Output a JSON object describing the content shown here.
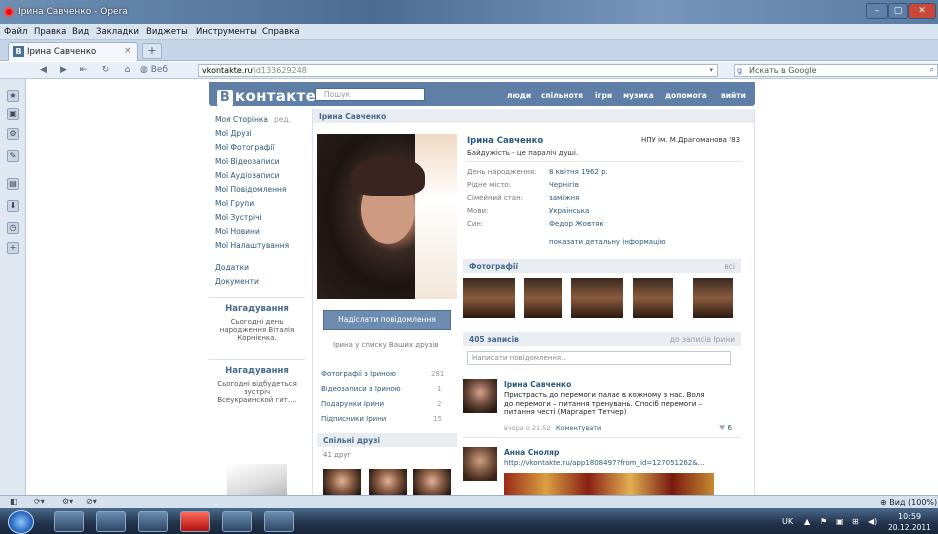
{
  "window": {
    "title": "Ірина Савченко - Opera",
    "min": "–",
    "max": "▢",
    "close": "✕"
  },
  "menu": [
    "Файл",
    "Правка",
    "Вид",
    "Закладки",
    "Виджеты",
    "Инструменты",
    "Справка"
  ],
  "tab": {
    "label": "Ірина Савченко",
    "close": "×",
    "new": "+"
  },
  "address": {
    "host": "vkontakte.ru",
    "path": "/id133629248",
    "web_label": "Веб"
  },
  "search": {
    "placeholder": "Искать в Google"
  },
  "vk": {
    "logo_b": "В",
    "logo": "контакте",
    "search_placeholder": "Пошук",
    "nav": [
      "люди",
      "спільнотя",
      "ігри",
      "музика",
      "допомога",
      "вийти"
    ],
    "left_menu": [
      "Моя Сторінка",
      "Мої Друзі",
      "Мої Фотографії",
      "Мої Відеозаписи",
      "Мої Аудіозаписи",
      "Мої Повідомлення",
      "Мої Групи",
      "Мої Зустрічі",
      "Мої Новини",
      "Мої Налаштування"
    ],
    "edit": "ред.",
    "extra_menu": [
      "Додатки",
      "Документи"
    ],
    "reminders": [
      {
        "title": "Нагадування",
        "text": "Сьогодні день народження Віталія Корнієнка."
      },
      {
        "title": "Нагадування",
        "text": "Сьогодні відбудеться зустріч Всеукраинской гит...."
      }
    ],
    "header": "Ірина Савченко",
    "profile": {
      "name": "Ірина Савченко",
      "school": "НПУ ім. М.Драгоманова '83",
      "status": "Байдужість - це параліч душі.",
      "fields": [
        {
          "label": "День народження:",
          "value": "8 квітня 1962 р."
        },
        {
          "label": "Рідне місто:",
          "value": "Чернігів"
        },
        {
          "label": "Сімейний стан:",
          "value": "заміжня"
        },
        {
          "label": "Мови:",
          "value": "Українська"
        },
        {
          "label": "Син:",
          "value": "Федор Жовтяк"
        }
      ],
      "details_link": "показати детальну інформацію"
    },
    "photos_header": "Фотографії",
    "photos_all": "всі",
    "send_message": "Надіслати повідомлення",
    "in_friends": "Ірина у списку Ваших друзів",
    "counts": [
      {
        "label": "Фотографії з Іриною",
        "value": "281"
      },
      {
        "label": "Відеозаписи з Іриною",
        "value": "1"
      },
      {
        "label": "Подарунки Ірини",
        "value": "2"
      },
      {
        "label": "Підписники Ірини",
        "value": "15"
      }
    ],
    "common_friends": "Спільні друзі",
    "friends_count": "41 друг",
    "wall_count": "405 записів",
    "wall_link": "до записів Ірини",
    "wall_placeholder": "Написати повідомлення..",
    "posts": [
      {
        "author": "Ірина Савченко",
        "text": "Пристрасть до перемоги палає в кожному з нас. Воля до перемоги – питання тренувань. Спосіб перемоги – питання честі (Маргарет Тетчер)",
        "time": "вчора о 21:52",
        "comment": "Коментувати",
        "likes": "6"
      },
      {
        "author": "Анна Сноляр",
        "text": "http://vkontakte.ru/app1808497?from_id=127051262&..."
      }
    ]
  },
  "status": {
    "zoom": "Вид (100%)"
  },
  "tray": {
    "lang": "UK",
    "time": "10:59",
    "date": "20.12.2011"
  }
}
